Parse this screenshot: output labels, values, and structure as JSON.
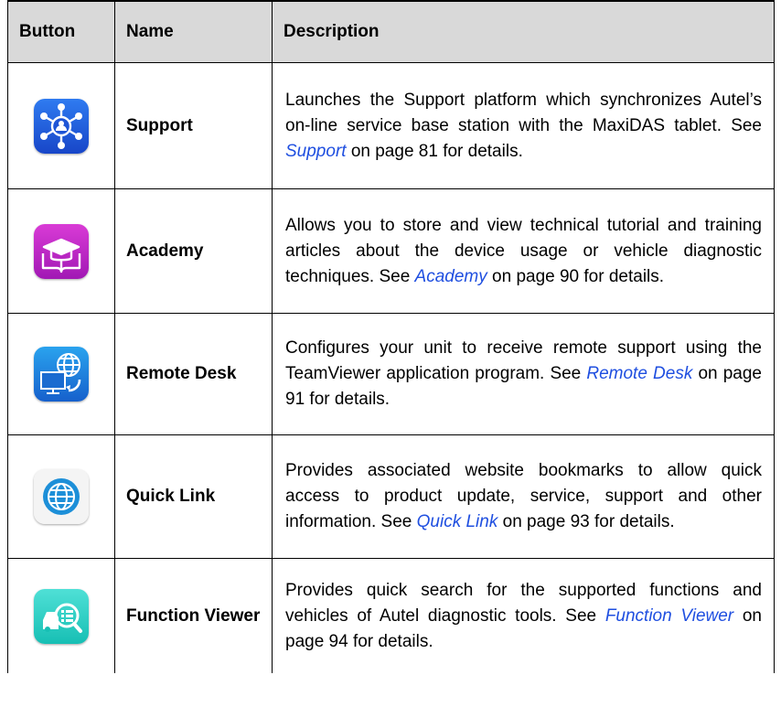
{
  "headers": {
    "button": "Button",
    "name": "Name",
    "description": "Description"
  },
  "rows": [
    {
      "name": "Support",
      "icon": "support-icon",
      "desc_pre": "Launches the Support platform which synchronizes Autel’s on-line service base station with the MaxiDAS tablet. See ",
      "link": "Support",
      "desc_post": " on page 81 for details."
    },
    {
      "name": "Academy",
      "icon": "academy-icon",
      "desc_pre": "Allows you to store and view technical tutorial and training articles about the device usage or vehicle diagnostic techniques. See ",
      "link": "Academy",
      "desc_post": " on page 90 for details."
    },
    {
      "name": "Remote Desk",
      "icon": "remote-desk-icon",
      "desc_pre": "Configures your unit to receive remote support using the TeamViewer application program. See ",
      "link": "Remote Desk",
      "desc_post": " on page 91 for details."
    },
    {
      "name": "Quick Link",
      "icon": "quick-link-icon",
      "desc_pre": "Provides associated website bookmarks to allow quick access to product update, service, support and other information. See ",
      "link": "Quick Link",
      "desc_post": " on page 93 for details."
    },
    {
      "name": "Function Viewer",
      "icon": "function-viewer-icon",
      "desc_pre": "Provides quick search for the supported functions and vehicles of Autel diagnostic tools. See ",
      "link": "Function Viewer",
      "desc_post": " on page 94 for details."
    }
  ],
  "colors": {
    "header_bg": "#d9d9d9",
    "link": "#1f4fe0"
  }
}
